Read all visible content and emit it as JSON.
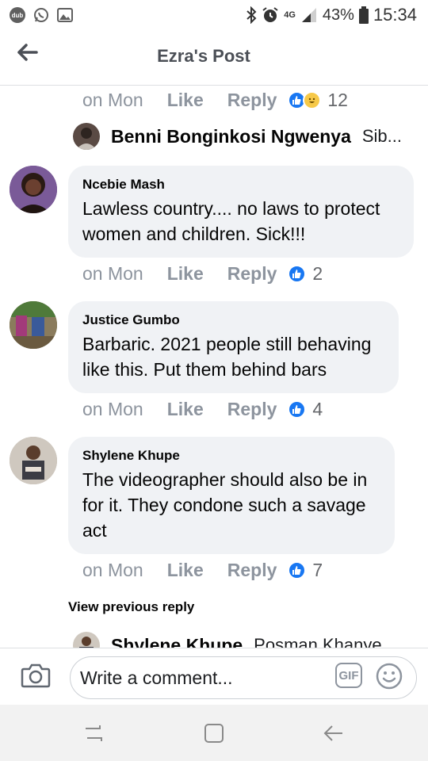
{
  "status_bar": {
    "dub_label": "dub",
    "network": "4G",
    "battery_pct": "43%",
    "time": "15:34"
  },
  "header": {
    "title": "Ezra's Post"
  },
  "first_actions": {
    "time": "on Mon",
    "like": "Like",
    "reply": "Reply",
    "count": "12"
  },
  "reply_preview": {
    "name": "Benni Bonginkosi Ngwenya",
    "text": "Sib..."
  },
  "comments": [
    {
      "author": "Ncebie Mash",
      "text": "Lawless country.... no laws to protect women and children. Sick!!!",
      "time": "on Mon",
      "like": "Like",
      "reply": "Reply",
      "count": "2"
    },
    {
      "author": "Justice Gumbo",
      "text": "Barbaric. 2021 people still behaving like this.  Put them behind bars",
      "time": "on Mon",
      "like": "Like",
      "reply": "Reply",
      "count": "4"
    },
    {
      "author": "Shylene Khupe",
      "text": "The videographer should also be in for it. They condone such a savage act",
      "time": "on Mon",
      "like": "Like",
      "reply": "Reply",
      "count": "7"
    }
  ],
  "view_previous_reply": "View previous reply",
  "partial_reply": {
    "name": "Shylene Khupe",
    "text": "Posman Khanye"
  },
  "composer": {
    "placeholder": "Write a comment...",
    "gif_label": "GIF"
  },
  "colors": {
    "like_blue": "#1877f2",
    "bubble_bg": "#f0f2f5",
    "muted_text": "#8d949e"
  }
}
